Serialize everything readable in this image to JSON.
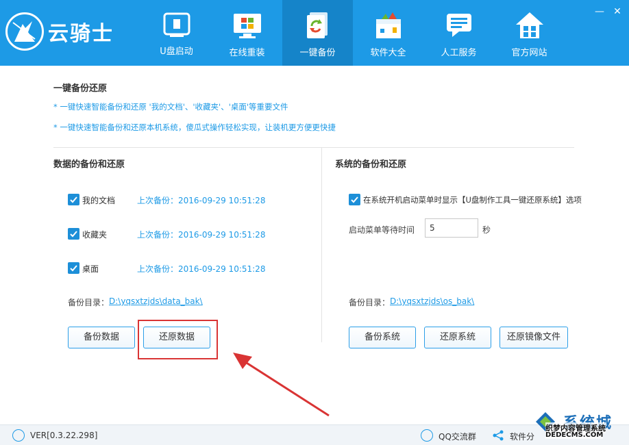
{
  "app": {
    "name": "云骑士",
    "brand_color": "#1d9ae6",
    "active_tab_color": "#1584c9",
    "window_controls": [
      "minimize-icon",
      "close-icon"
    ]
  },
  "tabs": [
    {
      "label": "U盘启动",
      "icon": "usb-icon"
    },
    {
      "label": "在线重装",
      "icon": "monitor-windows-icon"
    },
    {
      "label": "一键备份",
      "icon": "backup-refresh-icon",
      "active": true
    },
    {
      "label": "软件大全",
      "icon": "software-box-icon"
    },
    {
      "label": "人工服务",
      "icon": "chat-bubble-icon"
    },
    {
      "label": "官方网站",
      "icon": "home-icon"
    }
  ],
  "main": {
    "title": "一键备份还原",
    "notes": [
      "* 一键快速智能备份和还原 '我的文档'、'收藏夹'、'桌面'等重要文件",
      "* 一键快速智能备份和还原本机系统，傻瓜式操作轻松实现，让装机更方便更快捷"
    ]
  },
  "data_backup": {
    "title": "数据的备份和还原",
    "items": [
      {
        "label": "我的文档",
        "checked": true,
        "last_backup": "上次备份：2016-09-29 10:51:28"
      },
      {
        "label": "收藏夹",
        "checked": true,
        "last_backup": "上次备份：2016-09-29 10:51:28"
      },
      {
        "label": "桌面",
        "checked": true,
        "last_backup": "上次备份：2016-09-29 10:51:28"
      }
    ],
    "dir_label": "备份目录：",
    "dir_path": "D:\\yqsxtzjds\\data_bak\\",
    "buttons": {
      "backup": "备份数据",
      "restore": "还原数据"
    }
  },
  "system_backup": {
    "title": "系统的备份和还原",
    "show_in_boot_menu": {
      "checked": true,
      "label": "在系统开机启动菜单时显示【U盘制作工具一键还原系统】选项"
    },
    "wait_label": "启动菜单等待时间",
    "wait_value": "5",
    "wait_unit": "秒",
    "dir_label": "备份目录：",
    "dir_path": "D:\\yqsxtzjds\\os_bak\\",
    "buttons": {
      "backup": "备份系统",
      "restore": "还原系统",
      "restore_image": "还原镜像文件"
    }
  },
  "footer": {
    "version": "VER[0.3.22.298]",
    "qq_group": "QQ交流群",
    "share": "软件分"
  },
  "watermark": {
    "line1": "系统城",
    "line2": "织梦内容管理系统",
    "line3": "DEDECMS.COM"
  },
  "annotation": {
    "highlight_color": "#d93434",
    "highlighted": "还原数据"
  }
}
